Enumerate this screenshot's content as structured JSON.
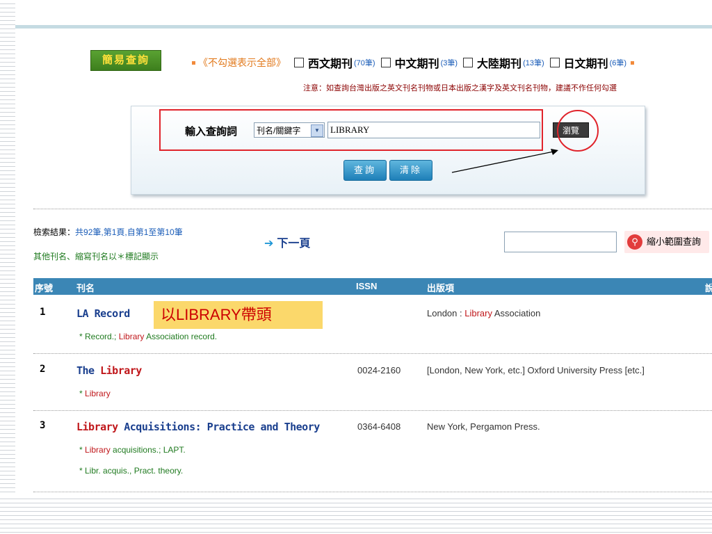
{
  "header": {
    "simple_query_label": "簡易查詢",
    "show_all_label": "《不勾選表示全部》",
    "categories": [
      {
        "name": "西文期刊",
        "count": "(70筆)"
      },
      {
        "name": "中文期刊",
        "count": "(3筆)"
      },
      {
        "name": "大陸期刊",
        "count": "(13筆)"
      },
      {
        "name": "日文期刊",
        "count": "(6筆)"
      }
    ],
    "note": "注意：如查詢台灣出版之英文刊名刊物或日本出版之漢字及英文刊名刊物，建議不作任何勾選"
  },
  "search": {
    "input_label": "輸入查詢詞",
    "type_selected": "刊名/關鍵字",
    "keyword_value": "LIBRARY",
    "browse_label": "瀏覽",
    "query_label": "查詢",
    "clear_label": "清除"
  },
  "results": {
    "summary_label": "檢索結果：",
    "summary_value": "共92筆,第1頁,自第1至第10筆",
    "other_note": "其他刊名、縮寫刊名以＊標記顯示",
    "next_page_label": "下一頁",
    "narrow_label": "縮小範圍查詢",
    "columns": [
      "序號",
      "刊名",
      "ISSN",
      "出版項",
      "說"
    ],
    "rows": [
      {
        "num": "1",
        "title_parts": [
          {
            "text": "LA Record",
            "hl": false
          }
        ],
        "issn": "",
        "pub_parts": [
          {
            "text": "London : ",
            "hl": false
          },
          {
            "text": "Library",
            "hl": true
          },
          {
            "text": " Association",
            "hl": false
          }
        ],
        "alts": [
          [
            {
              "text": "* Record.; ",
              "hl": false
            },
            {
              "text": "Library",
              "hl": true
            },
            {
              "text": " Association record.",
              "hl": false
            }
          ]
        ]
      },
      {
        "num": "2",
        "title_parts": [
          {
            "text": "The ",
            "hl": false
          },
          {
            "text": "Library",
            "hl": true
          }
        ],
        "issn": "0024-2160",
        "pub_parts": [
          {
            "text": "[London, New York, etc.] Oxford University Press [etc.]",
            "hl": false
          }
        ],
        "alts": [
          [
            {
              "text": "* ",
              "hl": false
            },
            {
              "text": "Library",
              "hl": true
            }
          ]
        ]
      },
      {
        "num": "3",
        "title_parts": [
          {
            "text": "Library",
            "hl": true
          },
          {
            "text": " Acquisitions: Practice and Theory",
            "hl": false
          }
        ],
        "issn": "0364-6408",
        "pub_parts": [
          {
            "text": "New York, Pergamon Press.",
            "hl": false
          }
        ],
        "alts": [
          [
            {
              "text": "* ",
              "hl": false
            },
            {
              "text": "Library",
              "hl": true
            },
            {
              "text": " acquisitions.; LAPT.",
              "hl": false
            }
          ],
          [
            {
              "text": "* Libr. acquis., Pract. theory.",
              "hl": false
            }
          ]
        ]
      }
    ]
  },
  "annotation": {
    "callout_text": "以LIBRARY帶頭"
  },
  "colors": {
    "accent_red": "#e0232b",
    "header_blue": "#3b86b5",
    "highlight_red": "#c0171b",
    "callout_yellow": "#fbd86b"
  }
}
